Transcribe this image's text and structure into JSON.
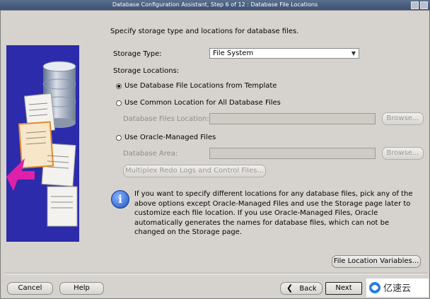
{
  "window": {
    "title": "Database Configuration Assistant, Step 6 of 12 : Database File Locations"
  },
  "instruction": "Specify storage type and locations for database files.",
  "storage_type": {
    "label": "Storage Type:",
    "value": "File System"
  },
  "storage_locations_label": "Storage Locations:",
  "options": {
    "template": "Use Database File Locations from Template",
    "common": "Use Common Location for All Database Files",
    "db_files_location_label": "Database Files Location:",
    "browse": "Browse...",
    "oracle_managed": "Use Oracle-Managed Files",
    "database_area_label": "Database Area:",
    "multiplex": "Multiplex Redo Logs and Control Files..."
  },
  "info": "If you want to specify different locations for any database files, pick any of the above options except Oracle-Managed Files and use the Storage page later to customize each file location. If you use Oracle-Managed Files, Oracle automatically generates the names for database files, which can not be changed on the Storage page.",
  "file_location_variables": "File Location Variables...",
  "footer": {
    "cancel": "Cancel",
    "help": "Help",
    "back": "Back",
    "next": "Next"
  },
  "watermark": "亿速云",
  "icons": [
    "info-icon",
    "back-arrow-icon",
    "dropdown-arrow-icon",
    "database-cylinder-icon",
    "document-stack-icon"
  ]
}
